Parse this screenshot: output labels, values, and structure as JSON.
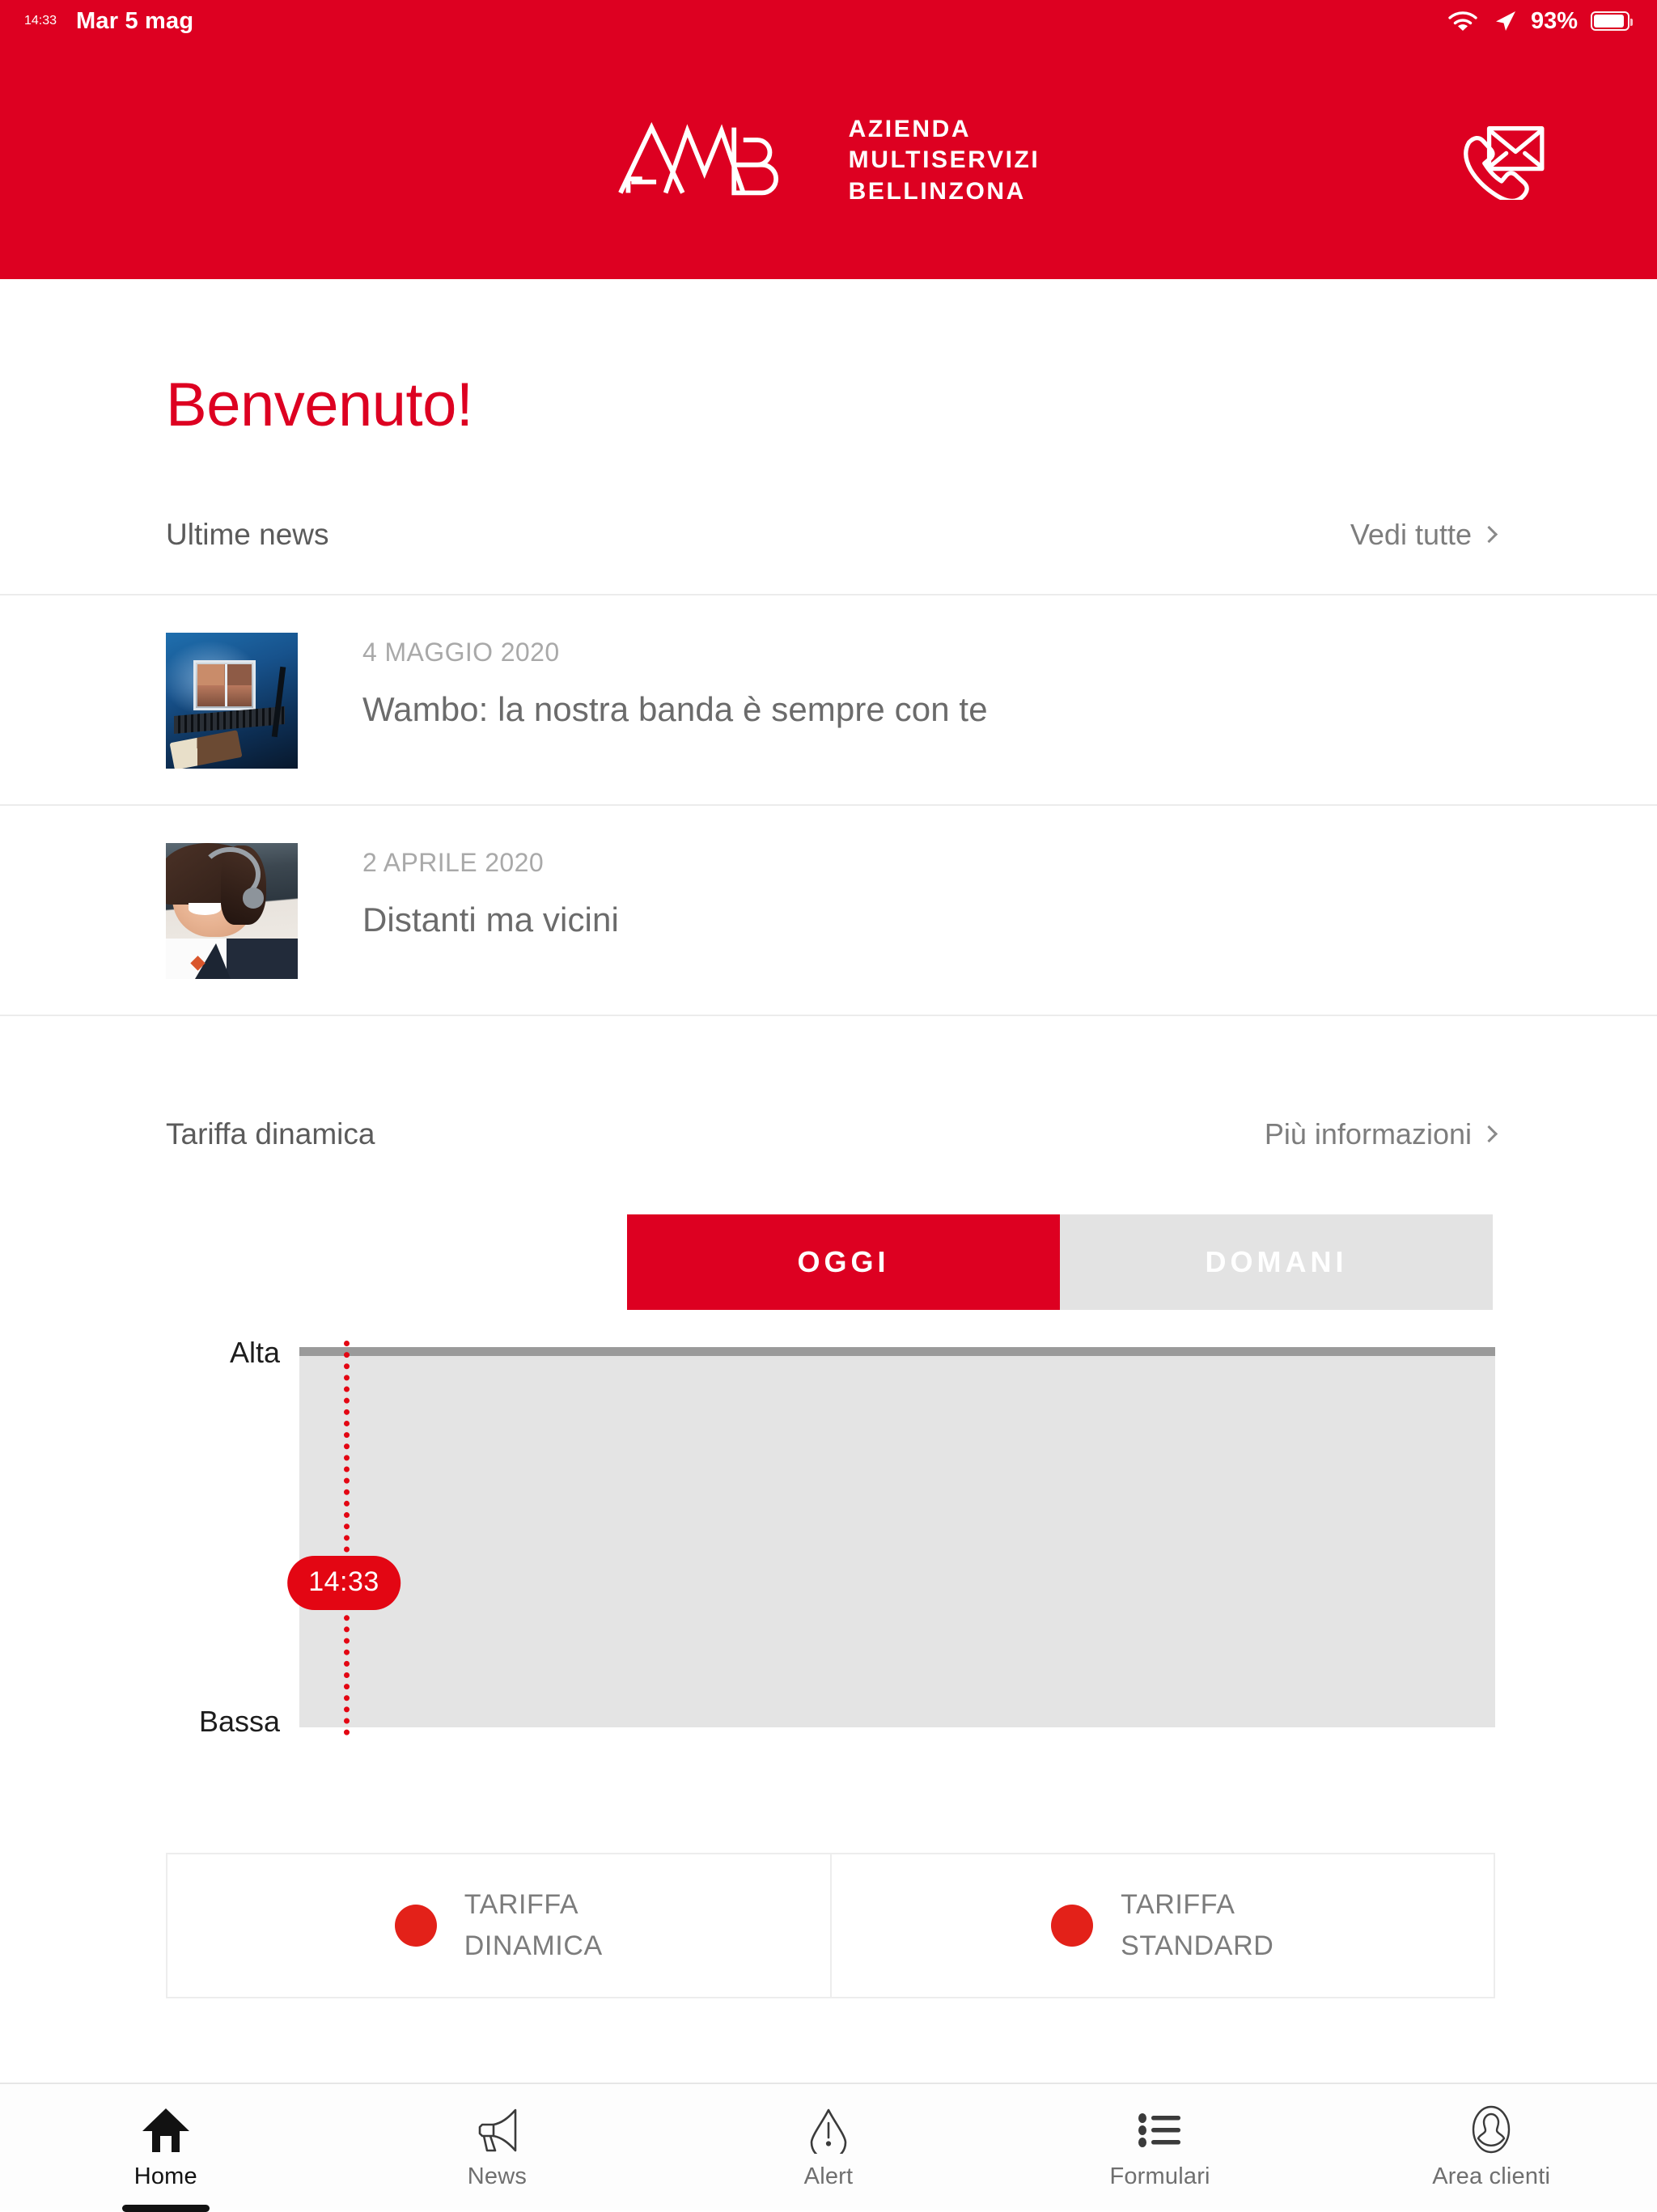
{
  "status_bar": {
    "time": "14:33",
    "date": "Mar 5 mag",
    "battery_percent": "93%",
    "wifi_icon": "wifi-icon",
    "location_icon": "location-arrow-icon",
    "battery_icon": "battery-icon"
  },
  "header": {
    "logo_mark": "amb-logo-mark",
    "logo_line1": "AZIENDA",
    "logo_line2": "MULTISERVIZI",
    "logo_line3": "BELLINZONA",
    "contact_icon": "phone-envelope-icon",
    "brand_color": "#DD0021"
  },
  "main": {
    "welcome_title": "Benvenuto!",
    "news_section": {
      "title": "Ultime news",
      "link_label": "Vedi tutte",
      "link_icon": "chevron-right-icon",
      "items": [
        {
          "date": "4 MAGGIO 2020",
          "title": "Wambo: la nostra banda è sempre con te",
          "thumbnail": "studio-monitor-photo"
        },
        {
          "date": "2 APRILE 2020",
          "title": "Distanti ma vicini",
          "thumbnail": "call-center-agent-photo"
        }
      ]
    },
    "tariff_section": {
      "title": "Tariffa dinamica",
      "link_label": "Più informazioni",
      "link_icon": "chevron-right-icon",
      "tabs": [
        {
          "label": "OGGI",
          "selected": true
        },
        {
          "label": "DOMANI",
          "selected": false
        }
      ],
      "legend_cards": [
        {
          "line1": "TARIFFA",
          "line2": "DINAMICA",
          "dot_color": "#e32119"
        },
        {
          "line1": "TARIFFA",
          "line2": "STANDARD",
          "dot_color": "#e32119"
        }
      ]
    }
  },
  "chart_data": {
    "type": "area",
    "title": "Tariffa dinamica",
    "xlabel": "",
    "ylabel": "",
    "categories": [
      "OGGI"
    ],
    "y_tick_labels": [
      "Alta",
      "Bassa"
    ],
    "ylim": [
      0,
      1
    ],
    "grid": false,
    "legend_position": "bottom",
    "series": [
      {
        "name": "TARIFFA DINAMICA",
        "color": "#e32119",
        "values": [
          1
        ]
      },
      {
        "name": "TARIFFA STANDARD",
        "color": "#e32119",
        "values": [
          1
        ]
      }
    ],
    "band": {
      "label": "Alta",
      "top_rule_color": "#9a9a9a",
      "fill_color": "#e4e4e4",
      "level": "Alta"
    },
    "annotations": [
      {
        "type": "vertical-marker",
        "label": "14:33",
        "color": "#e30613",
        "style": "dotted",
        "x_fraction": 0.147
      }
    ]
  },
  "tab_bar": {
    "items": [
      {
        "label": "Home",
        "icon": "home-icon",
        "active": true
      },
      {
        "label": "News",
        "icon": "megaphone-icon",
        "active": false
      },
      {
        "label": "Alert",
        "icon": "warning-triangle-icon",
        "active": false
      },
      {
        "label": "Formulari",
        "icon": "list-icon",
        "active": false
      },
      {
        "label": "Area clienti",
        "icon": "person-icon",
        "active": false
      }
    ]
  }
}
